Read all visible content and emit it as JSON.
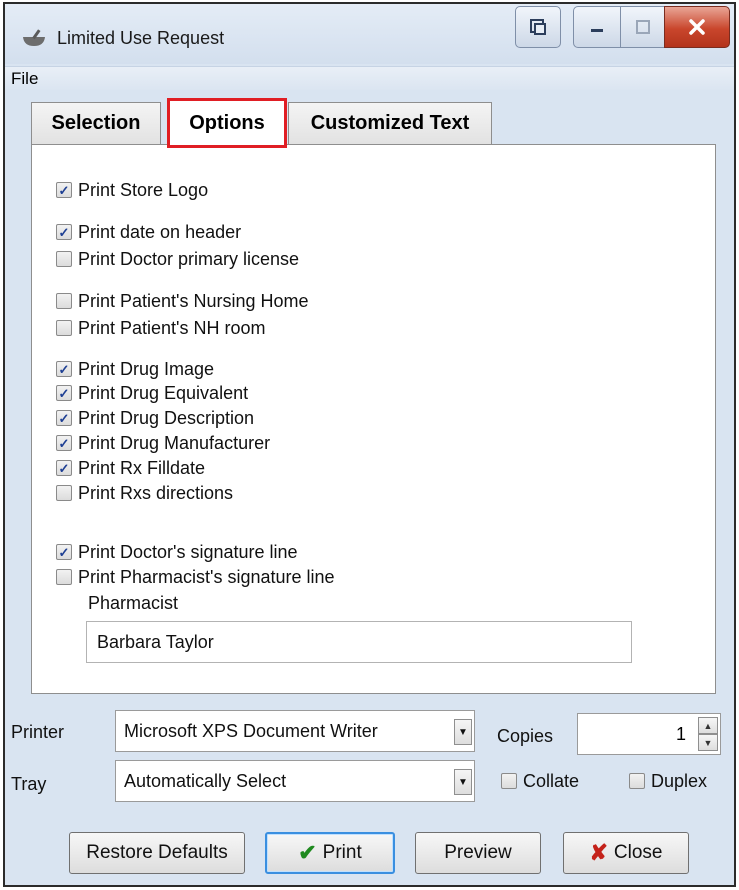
{
  "window": {
    "title": "Limited Use Request"
  },
  "menu": {
    "file": "File"
  },
  "tabs": [
    {
      "label": "Selection",
      "selected": false
    },
    {
      "label": "Options",
      "selected": true
    },
    {
      "label": "Customized Text",
      "selected": false
    }
  ],
  "options": [
    {
      "label": "Print Store Logo",
      "checked": true
    },
    {
      "label": "Print date on header",
      "checked": true
    },
    {
      "label": "Print Doctor primary license",
      "checked": false
    },
    {
      "label": "Print Patient's Nursing Home",
      "checked": false
    },
    {
      "label": "Print Patient's NH room",
      "checked": false
    },
    {
      "label": "Print Drug Image",
      "checked": true
    },
    {
      "label": "Print Drug Equivalent",
      "checked": true
    },
    {
      "label": "Print Drug Description",
      "checked": true
    },
    {
      "label": "Print Drug Manufacturer",
      "checked": true
    },
    {
      "label": "Print Rx Filldate",
      "checked": true
    },
    {
      "label": "Print Rxs directions",
      "checked": false
    },
    {
      "label": "Print Doctor's signature line",
      "checked": true
    },
    {
      "label": "Print Pharmacist's signature line",
      "checked": false
    }
  ],
  "pharmacist": {
    "label": "Pharmacist",
    "value": "Barbara Taylor"
  },
  "printer": {
    "label": "Printer",
    "value": "Microsoft XPS Document Writer"
  },
  "tray": {
    "label": "Tray",
    "value": "Automatically Select"
  },
  "copies": {
    "label": "Copies",
    "value": "1"
  },
  "collate": {
    "label": "Collate",
    "checked": false
  },
  "duplex": {
    "label": "Duplex",
    "checked": false
  },
  "buttons": {
    "restore": "Restore Defaults",
    "print": "Print",
    "preview": "Preview",
    "close": "Close"
  },
  "colors": {
    "highlight": "#e01e24",
    "check": "#1e3f93",
    "close_x": "#c4221a",
    "print_check": "#1f8a1f"
  }
}
